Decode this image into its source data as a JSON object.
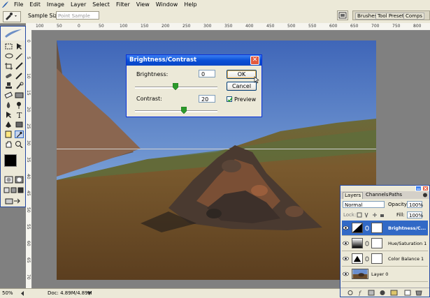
{
  "menubar": {
    "items": [
      "File",
      "Edit",
      "Image",
      "Layer",
      "Select",
      "Filter",
      "View",
      "Window",
      "Help"
    ]
  },
  "options_bar": {
    "sample_size_label": "Sample Size:",
    "sample_size_value": "Point Sample",
    "palette_tabs": [
      "Brushes",
      "Tool Presets",
      "Comps"
    ]
  },
  "rulers": {
    "h_ticks": [
      "100",
      "50",
      "0",
      "50",
      "100",
      "150",
      "200",
      "250",
      "300",
      "350",
      "400",
      "450",
      "500",
      "550",
      "600",
      "650",
      "700",
      "750",
      "800"
    ],
    "v_ticks": [
      "0",
      "5",
      "10",
      "15",
      "20",
      "25",
      "30",
      "35",
      "40",
      "45",
      "50",
      "55",
      "60",
      "65",
      "70"
    ]
  },
  "dialog": {
    "title": "Brightness/Contrast",
    "brightness_label": "Brightness:",
    "brightness_value": "0",
    "contrast_label": "Contrast:",
    "contrast_value": "20",
    "ok_label": "OK",
    "cancel_label": "Cancel",
    "preview_label": "Preview",
    "preview_checked": true
  },
  "status": {
    "zoom": "50%",
    "doc_info": "Doc: 4.89M/4.89M"
  },
  "layers_panel": {
    "tabs": [
      "Layers",
      "Channels",
      "Paths"
    ],
    "blend_mode": "Normal",
    "opacity_label": "Opacity:",
    "opacity_value": "100%",
    "lock_label": "Lock:",
    "fill_label": "Fill:",
    "fill_value": "100%",
    "layers": [
      {
        "name": "Brightness/C...",
        "selected": true
      },
      {
        "name": "Hue/Saturation 1",
        "selected": false
      },
      {
        "name": "Color Balance 1",
        "selected": false
      },
      {
        "name": "Layer 0",
        "selected": false
      }
    ]
  },
  "colors": {
    "accent_blue": "#0a4fd6",
    "selected_layer": "#3169c6",
    "chrome": "#ece9d8"
  }
}
